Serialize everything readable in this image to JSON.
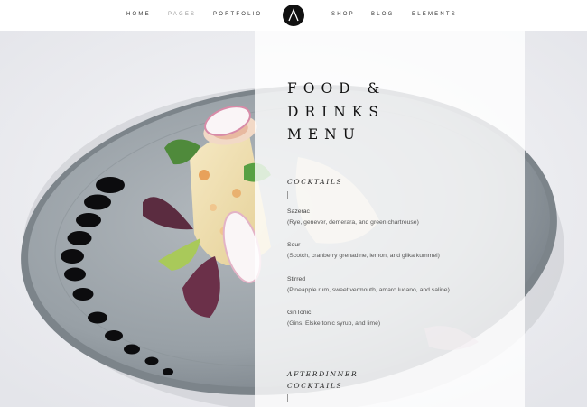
{
  "nav": {
    "left": [
      "HOME",
      "PAGES",
      "PORTFOLIO"
    ],
    "right": [
      "SHOP",
      "BLOG",
      "ELEMENTS"
    ],
    "active": "PAGES",
    "logo_icon": "lambda-logo-icon"
  },
  "menu": {
    "title_lines": [
      "FOOD &",
      "DRINKS",
      "MENU"
    ],
    "sections": [
      {
        "title_lines": [
          "COCKTAILS"
        ],
        "items": [
          {
            "name": "Sazerac",
            "desc": "(Rye, genever, demerara, and green chartreuse)"
          },
          {
            "name": "Sour",
            "desc": "(Scotch, cranberry grenadine, lemon, and gilka kummel)"
          },
          {
            "name": "Stirred",
            "desc": "(Pineapple rum, sweet vermouth, amaro lucano, and saline)"
          },
          {
            "name": "GinTonic",
            "desc": "(Gins, Elske tonic syrup, and lime)"
          }
        ]
      },
      {
        "title_lines": [
          "AFTERDINNER",
          "COCKTAILS"
        ],
        "items": []
      }
    ]
  },
  "colors": {
    "panel": "#ffffff",
    "text": "#111111",
    "plate": "#9aa2a8",
    "sauce": "#0c0c0e"
  }
}
